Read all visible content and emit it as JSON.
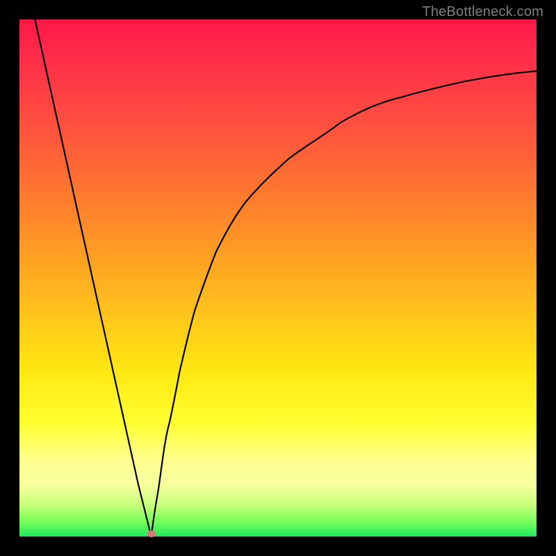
{
  "watermark": "TheBottleneck.com",
  "chart_data": {
    "type": "line",
    "title": "",
    "xlabel": "",
    "ylabel": "",
    "xlim": [
      0,
      100
    ],
    "ylim": [
      0,
      100
    ],
    "grid": false,
    "legend": false,
    "background_gradient": {
      "direction": "vertical",
      "stops": [
        {
          "pos": 0.0,
          "color": "#ff1748"
        },
        {
          "pos": 0.2,
          "color": "#ff4f3f"
        },
        {
          "pos": 0.46,
          "color": "#ffa022"
        },
        {
          "pos": 0.68,
          "color": "#ffe812"
        },
        {
          "pos": 0.85,
          "color": "#ffff8e"
        },
        {
          "pos": 0.97,
          "color": "#7aff5a"
        },
        {
          "pos": 1.0,
          "color": "#1fe85e"
        }
      ]
    },
    "series": [
      {
        "name": "left-line",
        "x": [
          3,
          7,
          11,
          15,
          19,
          23,
          25.5
        ],
        "y": [
          100,
          82,
          64,
          46,
          28,
          10,
          0
        ]
      },
      {
        "name": "right-curve",
        "x": [
          25.5,
          27,
          29,
          31,
          34,
          38,
          44,
          52,
          62,
          74,
          86,
          100
        ],
        "y": [
          0,
          10,
          22,
          32,
          44,
          55,
          65,
          73,
          80,
          85,
          88,
          90
        ]
      }
    ],
    "marker": {
      "x": 25.5,
      "y": 0,
      "color": "#d77a7a"
    }
  }
}
